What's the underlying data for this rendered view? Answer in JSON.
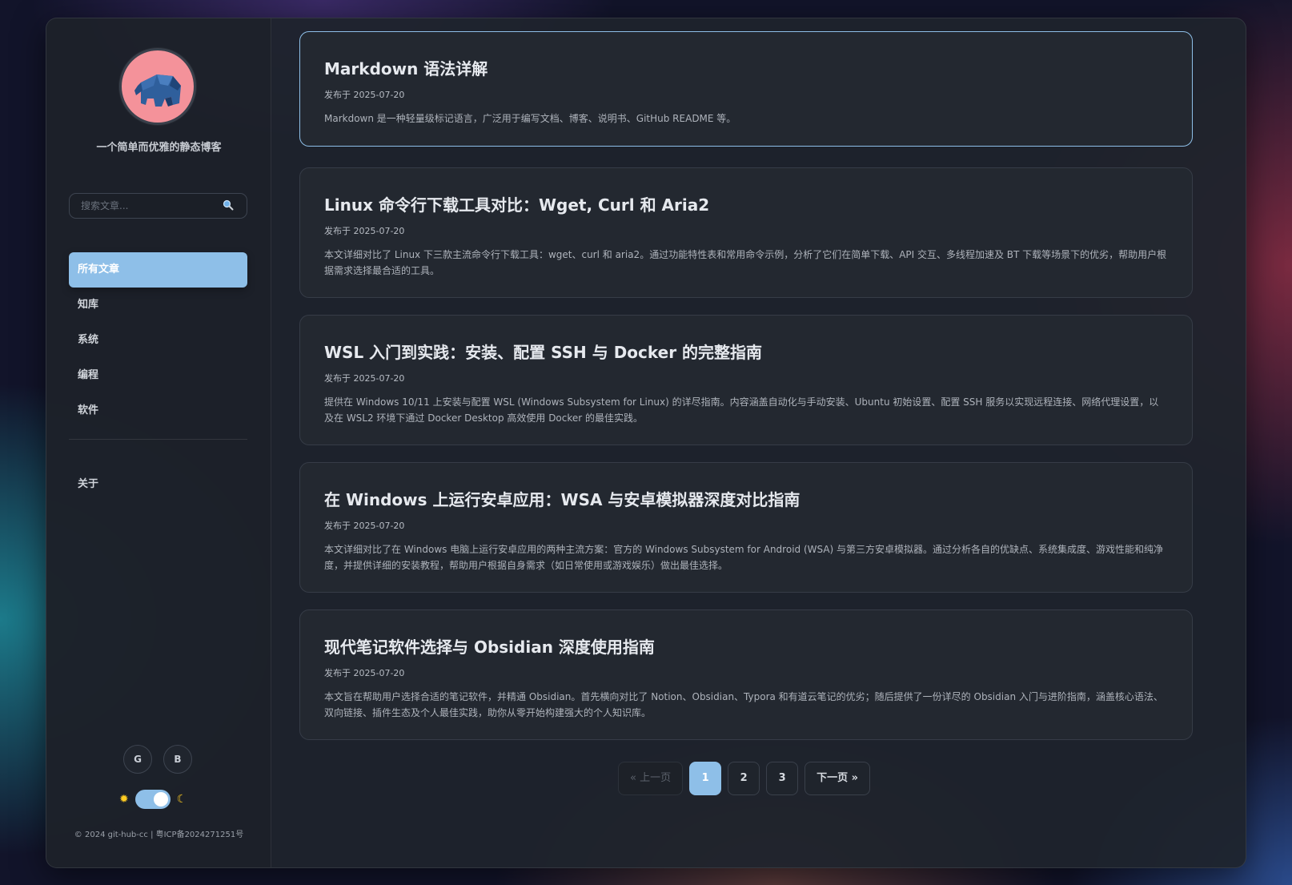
{
  "sidebar": {
    "tagline": "一个简单而优雅的静态博客",
    "search_placeholder": "搜索文章...",
    "nav_items": [
      {
        "label": "所有文章",
        "active": true
      },
      {
        "label": "知库",
        "active": false
      },
      {
        "label": "系统",
        "active": false
      },
      {
        "label": "编程",
        "active": false
      },
      {
        "label": "软件",
        "active": false
      }
    ],
    "about_label": "关于",
    "social": [
      "G",
      "B"
    ],
    "footer": "© 2024 git-hub-cc | 粤ICP备2024271251号"
  },
  "posts": [
    {
      "title": "Markdown 语法详解",
      "date": "发布于 2025-07-20",
      "desc": "Markdown 是一种轻量级标记语言，广泛用于编写文档、博客、说明书、GitHub README 等。"
    },
    {
      "title": "Linux 命令行下载工具对比：Wget, Curl 和 Aria2",
      "date": "发布于 2025-07-20",
      "desc": "本文详细对比了 Linux 下三款主流命令行下载工具：wget、curl 和 aria2。通过功能特性表和常用命令示例，分析了它们在简单下载、API 交互、多线程加速及 BT 下载等场景下的优劣，帮助用户根据需求选择最合适的工具。"
    },
    {
      "title": "WSL 入门到实践：安装、配置 SSH 与 Docker 的完整指南",
      "date": "发布于 2025-07-20",
      "desc": "提供在 Windows 10/11 上安装与配置 WSL (Windows Subsystem for Linux) 的详尽指南。内容涵盖自动化与手动安装、Ubuntu 初始设置、配置 SSH 服务以实现远程连接、网络代理设置，以及在 WSL2 环境下通过 Docker Desktop 高效使用 Docker 的最佳实践。"
    },
    {
      "title": "在 Windows 上运行安卓应用：WSA 与安卓模拟器深度对比指南",
      "date": "发布于 2025-07-20",
      "desc": "本文详细对比了在 Windows 电脑上运行安卓应用的两种主流方案：官方的 Windows Subsystem for Android (WSA) 与第三方安卓模拟器。通过分析各自的优缺点、系统集成度、游戏性能和纯净度，并提供详细的安装教程，帮助用户根据自身需求（如日常使用或游戏娱乐）做出最佳选择。"
    },
    {
      "title": "现代笔记软件选择与 Obsidian 深度使用指南",
      "date": "发布于 2025-07-20",
      "desc": "本文旨在帮助用户选择合适的笔记软件，并精通 Obsidian。首先横向对比了 Notion、Obsidian、Typora 和有道云笔记的优劣；随后提供了一份详尽的 Obsidian 入门与进阶指南，涵盖核心语法、双向链接、插件生态及个人最佳实践，助你从零开始构建强大的个人知识库。"
    }
  ],
  "pagination": {
    "prev": "« 上一页",
    "pages": [
      "1",
      "2",
      "3"
    ],
    "current": "1",
    "next": "下一页 »"
  },
  "theme": {
    "mode": "dark",
    "accent": "#8ebfe8"
  }
}
